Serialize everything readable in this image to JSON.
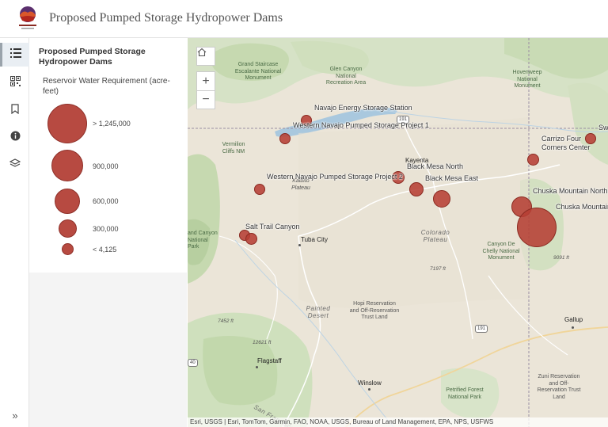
{
  "header": {
    "logo_text": "GRAND CANYON TRUST",
    "title": "Proposed Pumped Storage Hydropower Dams"
  },
  "rail": {
    "buttons": [
      {
        "icon": "legend-list-icon",
        "active": true
      },
      {
        "icon": "qr-code-icon",
        "active": false
      },
      {
        "icon": "bookmark-icon",
        "active": false
      },
      {
        "icon": "info-icon",
        "active": false
      },
      {
        "icon": "layers-icon",
        "active": false
      }
    ],
    "expand": "»"
  },
  "legend": {
    "title": "Proposed Pumped Storage Hydropower Dams",
    "field": "Reservoir Water Requirement (acre-feet)",
    "classes": [
      {
        "label": "> 1,245,000"
      },
      {
        "label": "900,000"
      },
      {
        "label": "600,000"
      },
      {
        "label": "300,000"
      },
      {
        "label": "< 4,125"
      }
    ],
    "color": "#b74a41"
  },
  "map_controls": {
    "home": "⌂",
    "zoom_in": "+",
    "zoom_out": "−"
  },
  "dams": [
    {
      "name": "Navajo Energy Storage Station"
    },
    {
      "name": "Western Navajo Pumped Storage Project 1"
    },
    {
      "name": "Black Mesa North"
    },
    {
      "name": "Western Navajo Pumped Storage Project 2"
    },
    {
      "name": "Black Mesa East"
    },
    {
      "name": "Salt Trail Canyon"
    },
    {
      "name": "Carrizo Four Corners Center"
    },
    {
      "name": "Chuska Mountain North"
    },
    {
      "name": "Chuska Mountain"
    },
    {
      "name": "Sw"
    }
  ],
  "places": {
    "grand_staircase": "Grand Staircase Escalante National Monument",
    "glen_canyon": "Glen Canyon National Recreation Area",
    "hovenweep": "Hovenweep National Monument",
    "vermilion": "Vermilion Cliffs NM",
    "kaibito": "Kaibito Plateau",
    "kayenta": "Kayenta",
    "grand_canyon": "and Canyon National Park",
    "tuba_city": "Tuba City",
    "colorado_plateau": "Colorado Plateau",
    "canyon_de_chelly": "Canyon De Chelly National Monument",
    "hopi": "Hopi Reservation and Off-Reservation Trust Land",
    "painted_desert": "Painted Desert",
    "gallup": "Gallup",
    "flagstaff": "Flagstaff",
    "winslow": "Winslow",
    "petrified": "Petrified Forest National Park",
    "zuni": "Zuni Reservation and Off-Reservation Trust Land",
    "san_francisco": "San Francisco",
    "a_label": "a",
    "grand_canyon_west": "ional Park"
  },
  "elevations": {
    "e1": "9091 ft",
    "e2": "7197 ft",
    "e3": "7452 ft",
    "e4": "12621 ft"
  },
  "shields": {
    "s1": "191",
    "s2": "191",
    "s3": "40",
    "s4": "98"
  },
  "attribution": "Esri, USGS | Esri, TomTom, Garmin, FAO, NOAA, USGS, Bureau of Land Management, EPA, NPS, USFWS"
}
